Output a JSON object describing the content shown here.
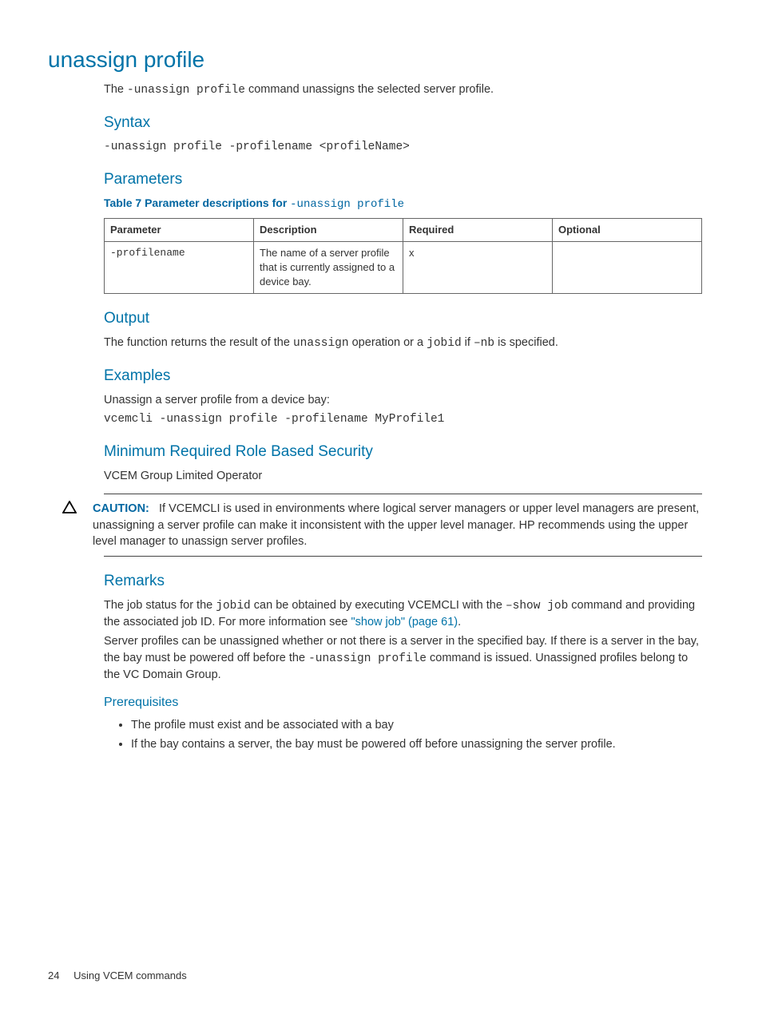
{
  "title": "unassign profile",
  "intro": {
    "pre": "The ",
    "cmd": "-unassign profile",
    "post": " command unassigns the selected server profile."
  },
  "syntax": {
    "heading": "Syntax",
    "code": "-unassign profile -profilename <profileName>"
  },
  "parameters": {
    "heading": "Parameters",
    "table_title_pre": "Table 7 Parameter descriptions for ",
    "table_title_cmd": "-unassign profile",
    "headers": {
      "param": "Parameter",
      "desc": "Description",
      "req": "Required",
      "opt": "Optional"
    },
    "rows": [
      {
        "param": "-profilename",
        "desc": "The name of a server profile that is currently assigned to a device bay.",
        "req": "x",
        "opt": ""
      }
    ]
  },
  "output": {
    "heading": "Output",
    "t1": "The function returns the result of the ",
    "c1": "unassign",
    "t2": " operation or a ",
    "c2": "jobid",
    "t3": " if ",
    "c3": "–nb",
    "t4": " is specified."
  },
  "examples": {
    "heading": "Examples",
    "line1": "Unassign a server profile from a device bay:",
    "code": "vcemcli -unassign profile -profilename MyProfile1"
  },
  "security": {
    "heading": "Minimum Required Role Based Security",
    "body": "VCEM Group Limited Operator"
  },
  "caution": {
    "label": "CAUTION:",
    "body": "If VCEMCLI is used in environments where logical server managers or upper level managers are present, unassigning a server profile can make it inconsistent with the upper level manager. HP recommends using the upper level manager to unassign server profiles."
  },
  "remarks": {
    "heading": "Remarks",
    "p1a": "The job status for the ",
    "p1b": "jobid",
    "p1c": " can be obtained by executing VCEMCLI with the ",
    "p1d": "–show job",
    "p1e": " command and providing the associated job ID. For more information see ",
    "link": "\"show job\" (page 61)",
    "p1f": ".",
    "p2a": "Server profiles can be unassigned whether or not there is a server in the specified bay. If there is a server in the bay, the bay must be powered off before the ",
    "p2b": "-unassign profile",
    "p2c": " command is issued. Unassigned profiles belong to the VC Domain Group."
  },
  "prereq": {
    "heading": "Prerequisites",
    "items": [
      "The profile must exist and be associated with a bay",
      "If the bay contains a server, the bay must be powered off before unassigning the server profile."
    ]
  },
  "footer": {
    "page": "24",
    "section": "Using VCEM commands"
  }
}
